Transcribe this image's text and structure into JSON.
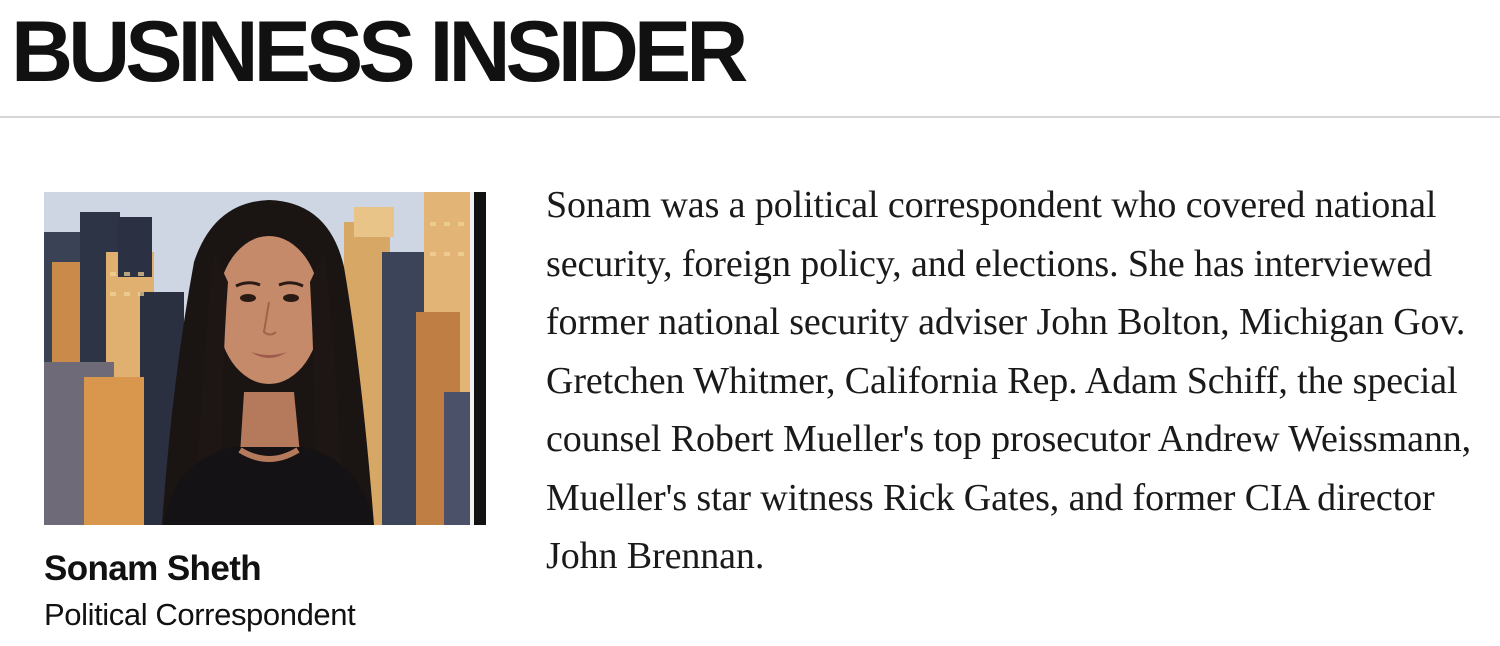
{
  "header": {
    "logo_text": "BUSINESS INSIDER"
  },
  "author": {
    "name": "Sonam Sheth",
    "title": "Political Correspondent",
    "photo_icon": "author-portrait",
    "bio": "Sonam was a political correspondent who covered national security, foreign policy, and elections. She has interviewed former national security adviser John Bolton, Michigan Gov. Gretchen Whitmer, California Rep. Adam Schiff, the special counsel Robert Mueller's top prosecutor Andrew Weissmann, Mueller's star witness Rick Gates, and former CIA director John Brennan."
  },
  "colors": {
    "text": "#111111",
    "divider": "#d6d6d6",
    "background": "#ffffff"
  }
}
